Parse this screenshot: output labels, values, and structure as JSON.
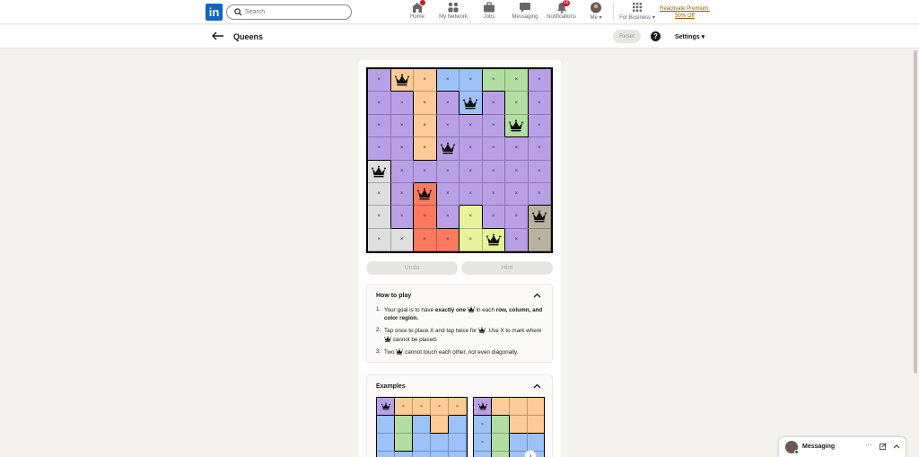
{
  "nav": {
    "logo_text": "in",
    "search_placeholder": "Search",
    "items": [
      {
        "label": "Home",
        "icon": "home-icon",
        "badge": ""
      },
      {
        "label": "My Network",
        "icon": "people-icon",
        "badge": ""
      },
      {
        "label": "Jobs",
        "icon": "briefcase-icon",
        "badge": ""
      },
      {
        "label": "Messaging",
        "icon": "chat-icon",
        "badge": ""
      },
      {
        "label": "Notifications",
        "icon": "bell-icon",
        "badge": "16"
      },
      {
        "label": "Me",
        "icon": "avatar",
        "badge": ""
      },
      {
        "label": "For Business",
        "icon": "grid-icon",
        "badge": ""
      }
    ],
    "premium_line1": "Reactivate Premium:",
    "premium_line2": "50% Off"
  },
  "header": {
    "title": "Queens",
    "reset_label": "Reset",
    "help_label": "?",
    "settings_label": "Settings"
  },
  "colors": {
    "P": "#b9a0e6",
    "O": "#fecb96",
    "B": "#9dc2fa",
    "G": "#b3dea2",
    "W": "#dfdfdf",
    "R": "#fe7a5e",
    "Y": "#e7f39a",
    "T": "#b9b29e"
  },
  "board": {
    "regions": [
      "POOBBGGP",
      "PPOPBPGP",
      "PPOPPPGP",
      "PPOPPPPP",
      "WPPPPPPP",
      "WPRPPPPP",
      "WPRPYPPT",
      "WWRRYYPT"
    ],
    "marks": [
      "xQxxxxxx",
      "xxxxQxxx",
      "xxxxxxQx",
      "xxxQxxxx",
      "Qxxxxxxx",
      "xxQxxxxx",
      "xxxxxxxQ",
      "xxxxxQxx"
    ]
  },
  "actions": {
    "undo_label": "Undo",
    "hint_label": "Hint"
  },
  "how_to_play": {
    "title": "How to play",
    "r1_num": "1.",
    "r1_a": "Your goal is to have ",
    "r1_b": "exactly one",
    "r1_c": " in each ",
    "r1_d": "row, column, and color region.",
    "r2_num": "2.",
    "r2_a": "Tap once to place X and tap twice for",
    "r2_b": ". Use X to mark where",
    "r2_c": "cannot be placed.",
    "r3_num": "3.",
    "r3_a": "Two",
    "r3_b": "cannot touch each other, not even diagonally."
  },
  "examples": {
    "title": "Examples",
    "ex1_regions": [
      "POOOO",
      "BGBOB",
      "BGBBB",
      "BBBBB"
    ],
    "ex1_marks": [
      "Qxxxx",
      "     ",
      "     ",
      "     "
    ],
    "ex2_regions": [
      "POOOO",
      "BGOOO",
      "BGBBB",
      "BGBBB"
    ],
    "ex2_marks": [
      "Q    ",
      "x    ",
      "x    ",
      "     "
    ]
  },
  "messaging": {
    "label": "Messaging",
    "more": "···"
  }
}
